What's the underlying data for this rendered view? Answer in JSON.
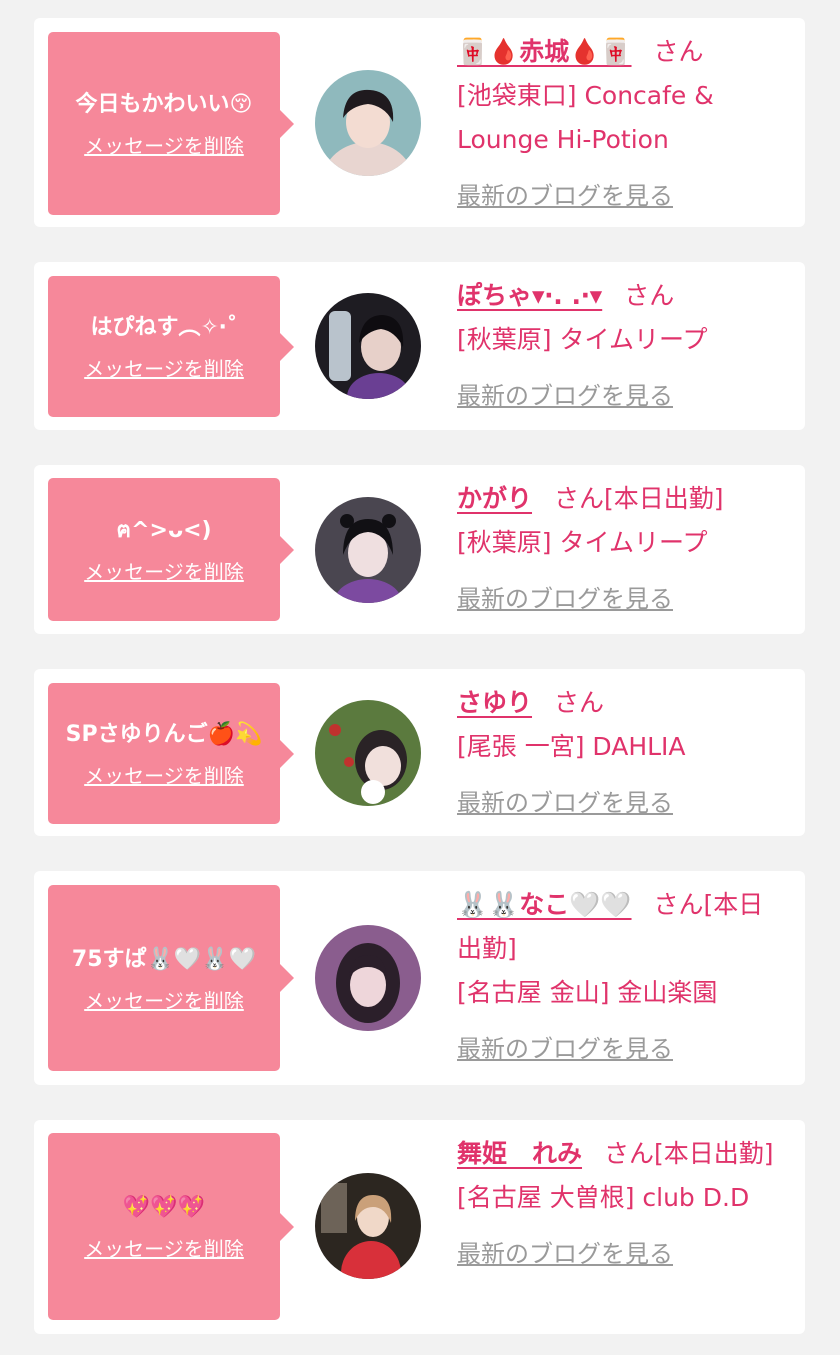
{
  "delete_label": "メッセージを削除",
  "blog_label": "最新のブログを見る",
  "colors": {
    "bubble": "#f6889a",
    "accent": "#e0336b",
    "link_gray": "#9a9a9a",
    "background": "#f2f2f2"
  },
  "entries": [
    {
      "message": "今日もかわいい😚",
      "name": "🀄🩸赤城🩸🀄",
      "suffix": "さん",
      "store": "[池袋東口] Concafe & Lounge Hi-Potion"
    },
    {
      "message": "はぴねす︵✧‧˚",
      "name": "ぽちゃ▾‧. .‧▾",
      "suffix": "さん",
      "store": "[秋葉原] タイムリープ"
    },
    {
      "message": "ฅ^>ᴗ<)",
      "name": "かがり",
      "suffix": "さん[本日出勤]",
      "store": "[秋葉原] タイムリープ"
    },
    {
      "message": "SPさゆりんご🍎💫",
      "name": "さゆり",
      "suffix": "さん",
      "store": "[尾張 一宮] DAHLIA"
    },
    {
      "message": "75すぱ🐰🤍🐰🤍",
      "name": "🐰🐰なこ🤍🤍",
      "suffix": "さん[本日出勤]",
      "store": "[名古屋 金山] 金山楽園"
    },
    {
      "message": "💖💖💖",
      "name": "舞姫　れみ",
      "suffix": "さん[本日出勤]",
      "store": "[名古屋 大曽根] club D.D"
    }
  ]
}
